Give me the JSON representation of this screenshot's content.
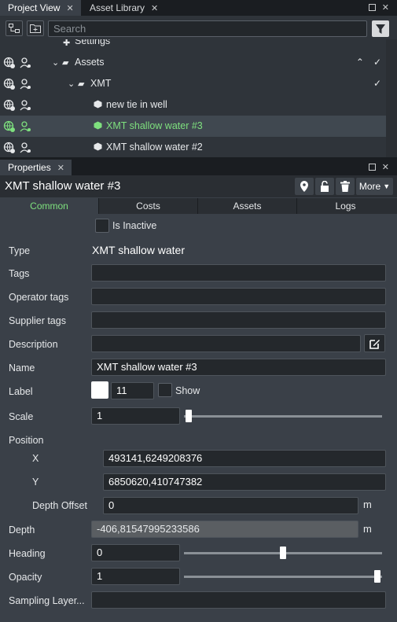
{
  "top_panel": {
    "tabs": [
      {
        "label": "Project View",
        "active": true
      },
      {
        "label": "Asset Library",
        "active": false
      }
    ],
    "search": {
      "placeholder": "Search"
    },
    "tree": [
      {
        "label": "Settings",
        "partial": true
      },
      {
        "label": "Assets",
        "type": "folder-open",
        "selected": false
      },
      {
        "label": "XMT",
        "type": "folder-open",
        "selected": false
      },
      {
        "label": "new tie in well",
        "type": "cube",
        "selected": false
      },
      {
        "label": "XMT shallow water #3",
        "type": "cube",
        "selected": true
      },
      {
        "label": "XMT shallow water #2",
        "type": "cube",
        "selected": false
      }
    ]
  },
  "properties_panel": {
    "tab_label": "Properties",
    "title": "XMT shallow water #3",
    "more_label": "More",
    "tabs": [
      "Common",
      "Costs",
      "Assets",
      "Logs"
    ],
    "is_inactive_label": "Is Inactive",
    "fields": {
      "type_label": "Type",
      "type_value": "XMT shallow water",
      "tags_label": "Tags",
      "tags_value": "",
      "operator_tags_label": "Operator tags",
      "operator_tags_value": "",
      "supplier_tags_label": "Supplier tags",
      "supplier_tags_value": "",
      "description_label": "Description",
      "description_value": "",
      "name_label": "Name",
      "name_value": "XMT shallow water #3",
      "label_label": "Label",
      "label_size": "11",
      "show_label": "Show",
      "scale_label": "Scale",
      "scale_value": "1",
      "scale_slider_fraction": 0.0,
      "position_label": "Position",
      "x_label": "X",
      "x_value": "493141,6249208376",
      "y_label": "Y",
      "y_value": "6850620,410747382",
      "depth_offset_label": "Depth Offset",
      "depth_offset_value": "0",
      "depth_offset_unit": "m",
      "depth_label": "Depth",
      "depth_value": "-406,81547995233586",
      "depth_unit": "m",
      "heading_label": "Heading",
      "heading_value": "0",
      "heading_slider_fraction": 0.5,
      "opacity_label": "Opacity",
      "opacity_value": "1",
      "opacity_slider_fraction": 1.0,
      "sampling_layer_label": "Sampling Layer...",
      "sampling_layer_value": ""
    }
  },
  "colors": {
    "accent_green": "#7ee07e",
    "panel_bg": "#3a4048",
    "dark_bg": "#1a1d21"
  }
}
